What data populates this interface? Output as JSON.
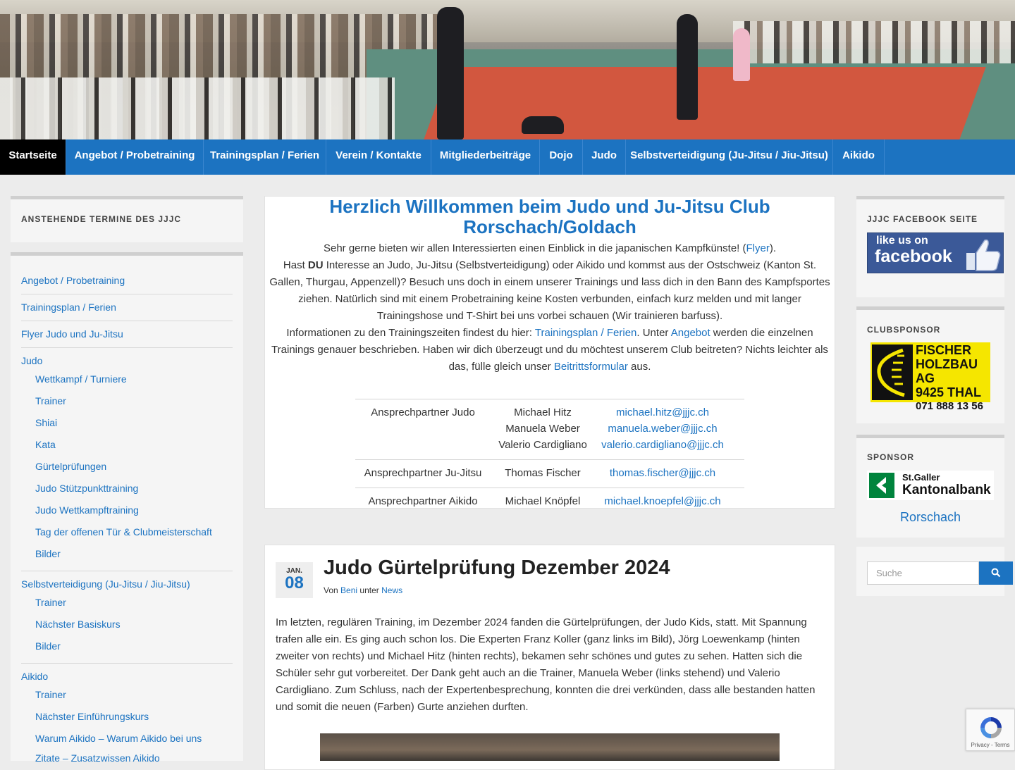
{
  "nav": {
    "items": [
      "Startseite",
      "Angebot / Probetraining",
      "Trainingsplan / Ferien",
      "Verein / Kontakte",
      "Mitgliederbeiträge",
      "Dojo",
      "Judo",
      "Selbstverteidigung (Ju-Jitsu / Jiu-Jitsu)",
      "Aikido"
    ]
  },
  "left": {
    "events_title": "ANSTEHENDE TERMINE DES JJJC",
    "menu": {
      "top1": "Angebot / Probetraining",
      "top2": "Trainingsplan / Ferien",
      "top3": "Flyer Judo und Ju-Jitsu",
      "judo": "Judo",
      "judo_sub": [
        "Wettkampf / Turniere",
        "Trainer",
        "Shiai",
        "Kata",
        "Gürtelprüfungen",
        "Judo Stützpunkttraining",
        "Judo Wettkampftraining",
        "Tag der offenen Tür & Clubmeisterschaft",
        "Bilder"
      ],
      "sv": "Selbstverteidigung (Ju-Jitsu / Jiu-Jitsu)",
      "sv_sub": [
        "Trainer",
        "Nächster Basiskurs",
        "Bilder"
      ],
      "aikido": "Aikido",
      "aikido_sub": [
        "Trainer",
        "Nächster Einführungskurs",
        "Warum Aikido – Warum Aikido bei uns",
        "Zitate – Zusatzwissen Aikido"
      ]
    }
  },
  "welcome": {
    "title_line1": "Herzlich Willkommen beim Judo und Ju-Jitsu Club",
    "title_line2": "Rorschach/Goldach",
    "intro_pre": "Sehr gerne bieten wir allen Interessierten einen Einblick in die japanischen Kampfkünste! (",
    "intro_link": "Flyer",
    "intro_post": ").",
    "p1_hast": "Hast ",
    "p1_du": "DU",
    "p1_l1": " Interesse an Judo, Ju-Jitsu (Selbstverteidigung) oder Aikido und kommst aus der Ostschweiz (Kanton St.",
    "p1_l2": "Gallen, Thurgau, Appenzell)? Besuch uns doch in einem unserer Trainings und lass dich in den Bann des Kampfsportes",
    "p1_l3": "ziehen. Natürlich sind mit einem Probetraining keine Kosten verbunden, einfach kurz melden und mit langer",
    "p1_l4": "Trainingshose und T-Shirt bei uns vorbei schauen (Wir trainieren barfuss).",
    "p2_pre": "Informationen zu den Trainingszeiten findest du hier: ",
    "p2_link1": "Trainingsplan / Ferien",
    "p2_mid": ". Unter ",
    "p2_link2": "Angebot",
    "p2_post": " werden die einzelnen",
    "p2_l2": "Trainings genauer beschrieben. Haben wir dich überzeugt und du möchtest unserem Club beitreten? Nichts leichter als",
    "p2_l3_pre": "das, fülle gleich unser ",
    "p2_l3_link": "Beitrittsformular",
    "p2_l3_post": " aus."
  },
  "contacts": [
    {
      "role": "Ansprechpartner Judo",
      "names": [
        "Michael Hitz",
        "Manuela Weber",
        "Valerio Cardigliano"
      ],
      "emails": [
        "michael.hitz@jjjc.ch",
        "manuela.weber@jjjc.ch",
        "valerio.cardigliano@jjjc.ch"
      ]
    },
    {
      "role": "Ansprechpartner Ju-Jitsu",
      "names": [
        "Thomas Fischer"
      ],
      "emails": [
        "thomas.fischer@jjjc.ch"
      ]
    },
    {
      "role": "Ansprechpartner Aikido",
      "names": [
        "Michael Knöpfel"
      ],
      "emails": [
        "michael.knoepfel@jjjc.ch"
      ]
    }
  ],
  "post": {
    "month": "JAN.",
    "day": "08",
    "title": "Judo Gürtelprüfung Dezember 2024",
    "meta_by": "Von ",
    "author": "Beni",
    "meta_in": " unter ",
    "category": "News",
    "body": "Im letzten, regulären Training, im Dezember 2024 fanden die Gürtelprüfungen, der Judo Kids, statt. Mit Spannung trafen alle ein. Es ging auch schon los. Die Experten Franz Koller (ganz links im Bild), Jörg Loewenkamp (hinten zweiter von rechts) und Michael Hitz (hinten rechts), bekamen sehr schönes und gutes zu sehen. Hatten sich die Schüler sehr gut vorbereitet. Der Dank geht auch an die Trainer, Manuela Weber (links stehend) und Valerio Cardigliano. Zum Schluss, nach der Expertenbesprechung, konnten die drei verkünden, dass alle bestanden hatten und somit die neuen (Farben) Gurte anziehen durften."
  },
  "right": {
    "fb_title": "JJJC FACEBOOK SEITE",
    "fb_like": "like us on",
    "fb_brand": "facebook",
    "club_title": "CLUBSPONSOR",
    "club_lines": [
      "FISCHER",
      "HOLZBAU AG",
      "9425 THAL",
      "071 888 13 56"
    ],
    "sponsor_title": "SPONSOR",
    "bank_l1": "St.Galler",
    "bank_l2": "Kantonalbank",
    "bank_city": "Rorschach",
    "search_placeholder": "Suche"
  },
  "colors": {
    "primary": "#1c73c1",
    "nav_active": "#000000",
    "sponsor_yellow": "#f5e600",
    "fb_blue": "#3b5998",
    "bank_green": "#00843d"
  }
}
